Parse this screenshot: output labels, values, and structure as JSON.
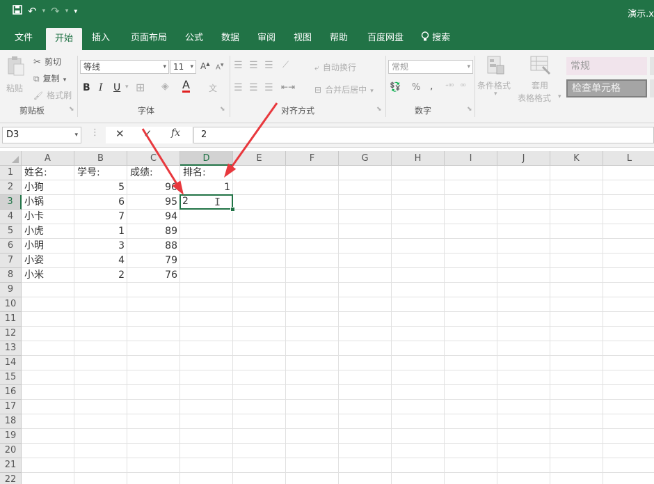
{
  "window": {
    "title": "演示.x"
  },
  "quick_access": {
    "save_icon": "save-icon",
    "undo_icon": "undo-icon",
    "redo_icon": "redo-icon"
  },
  "tabs": [
    {
      "label": "文件"
    },
    {
      "label": "开始"
    },
    {
      "label": "插入"
    },
    {
      "label": "页面布局"
    },
    {
      "label": "公式"
    },
    {
      "label": "数据"
    },
    {
      "label": "审阅"
    },
    {
      "label": "视图"
    },
    {
      "label": "帮助"
    },
    {
      "label": "百度网盘"
    },
    {
      "label": "搜索"
    }
  ],
  "ribbon": {
    "clipboard": {
      "paste": "粘贴",
      "cut": "剪切",
      "copy": "复制",
      "format_painter": "格式刷",
      "label": "剪贴板"
    },
    "font": {
      "name": "等线",
      "size": "11",
      "bold": "B",
      "italic": "I",
      "underline": "U",
      "label": "字体",
      "font_color": "A"
    },
    "alignment": {
      "wrap": "自动换行",
      "merge": "合并后居中",
      "label": "对齐方式"
    },
    "number": {
      "format": "常规",
      "percent": "%",
      "comma": ",",
      "label": "数字"
    },
    "styles": {
      "conditional": "条件格式",
      "table_format_1": "套用",
      "table_format_2": "表格格式",
      "style_normal": "常规",
      "style_check": "检查单元格"
    }
  },
  "formula_bar": {
    "name_box": "D3",
    "cancel": "✕",
    "enter": "✓",
    "fx": "fx",
    "value": "2"
  },
  "sheet": {
    "columns": [
      "A",
      "B",
      "C",
      "D",
      "E",
      "F",
      "G",
      "H",
      "I",
      "J",
      "K",
      "L"
    ],
    "rows": [
      "1",
      "2",
      "3",
      "4",
      "5",
      "6",
      "7",
      "8",
      "9",
      "10",
      "11",
      "12",
      "13",
      "14",
      "15",
      "16",
      "17",
      "18",
      "19",
      "20",
      "21",
      "22"
    ],
    "active_cell": "D3",
    "active_value": "2",
    "data": [
      {
        "a": "姓名:",
        "b": "学号:",
        "c": "成绩:",
        "d": "排名:"
      },
      {
        "a": "小狗",
        "b": "5",
        "c": "96",
        "d": "1"
      },
      {
        "a": "小锅",
        "b": "6",
        "c": "95",
        "d": ""
      },
      {
        "a": "小卡",
        "b": "7",
        "c": "94",
        "d": ""
      },
      {
        "a": "小虎",
        "b": "1",
        "c": "89",
        "d": ""
      },
      {
        "a": "小明",
        "b": "3",
        "c": "88",
        "d": ""
      },
      {
        "a": "小姿",
        "b": "4",
        "c": "79",
        "d": ""
      },
      {
        "a": "小米",
        "b": "2",
        "c": "76",
        "d": ""
      }
    ]
  },
  "colors": {
    "accent": "#217346",
    "arrow": "#e8383d"
  }
}
